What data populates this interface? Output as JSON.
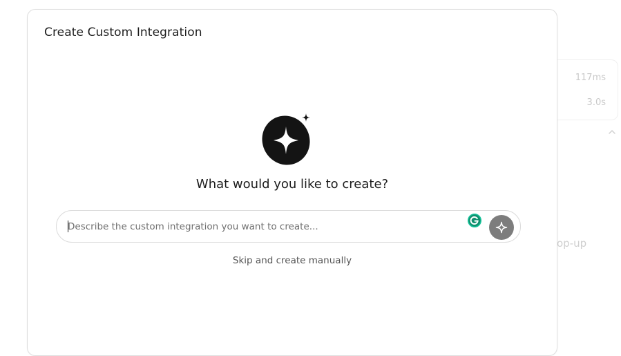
{
  "background": {
    "metrics": [
      "117ms",
      "3.0s"
    ],
    "partial_text": "op-up"
  },
  "modal": {
    "title": "Create Custom Integration",
    "heading": "What would you like to create?",
    "input": {
      "value": "",
      "placeholder": "Describe the custom integration you want to create..."
    },
    "skip_label": "Skip and create manually"
  },
  "icons": {
    "hero": "sparkle-badge-icon",
    "grammarly": "grammarly-icon",
    "send": "sparkle-icon",
    "chevron": "chevron-up-icon"
  },
  "colors": {
    "send_button": "#7d7d7d",
    "hero_fill": "#141414",
    "grammarly_green": "#15c39a"
  }
}
